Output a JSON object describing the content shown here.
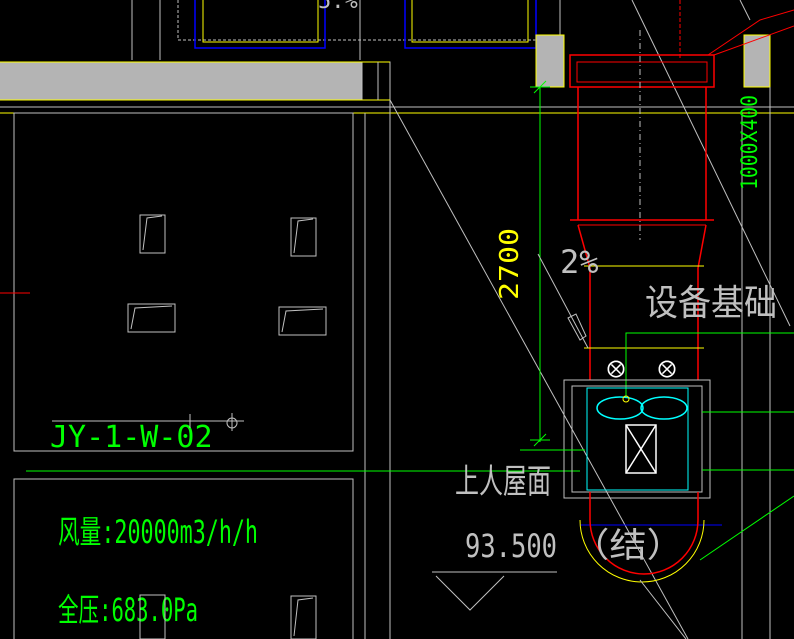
{
  "drawing": {
    "background": "#000000",
    "colors": {
      "green": "#00ff00",
      "yellow": "#ffff00",
      "red": "#ff0000",
      "cyan": "#00ffff",
      "white": "#ffffff",
      "gray": "#c0c0c0",
      "blue": "#0000ff",
      "slab_fill": "#b4b4b4"
    },
    "labels": {
      "top_fragment": "5.%",
      "duct_size": "1000X400",
      "height_dim": "2700",
      "slope": "2%",
      "equipment_base": "设备基础",
      "unit_tag": "JY-1-W-02",
      "roof_label": "上人屋面",
      "elevation": "93.500",
      "structural": "（结）",
      "airflow": "风量:20000m3/h/h",
      "pressure": "全压:683.0Pa"
    },
    "symbols": {
      "fan": "fan-icon",
      "damper": "damper-icon",
      "level_marker": "level-triangle-icon"
    }
  }
}
